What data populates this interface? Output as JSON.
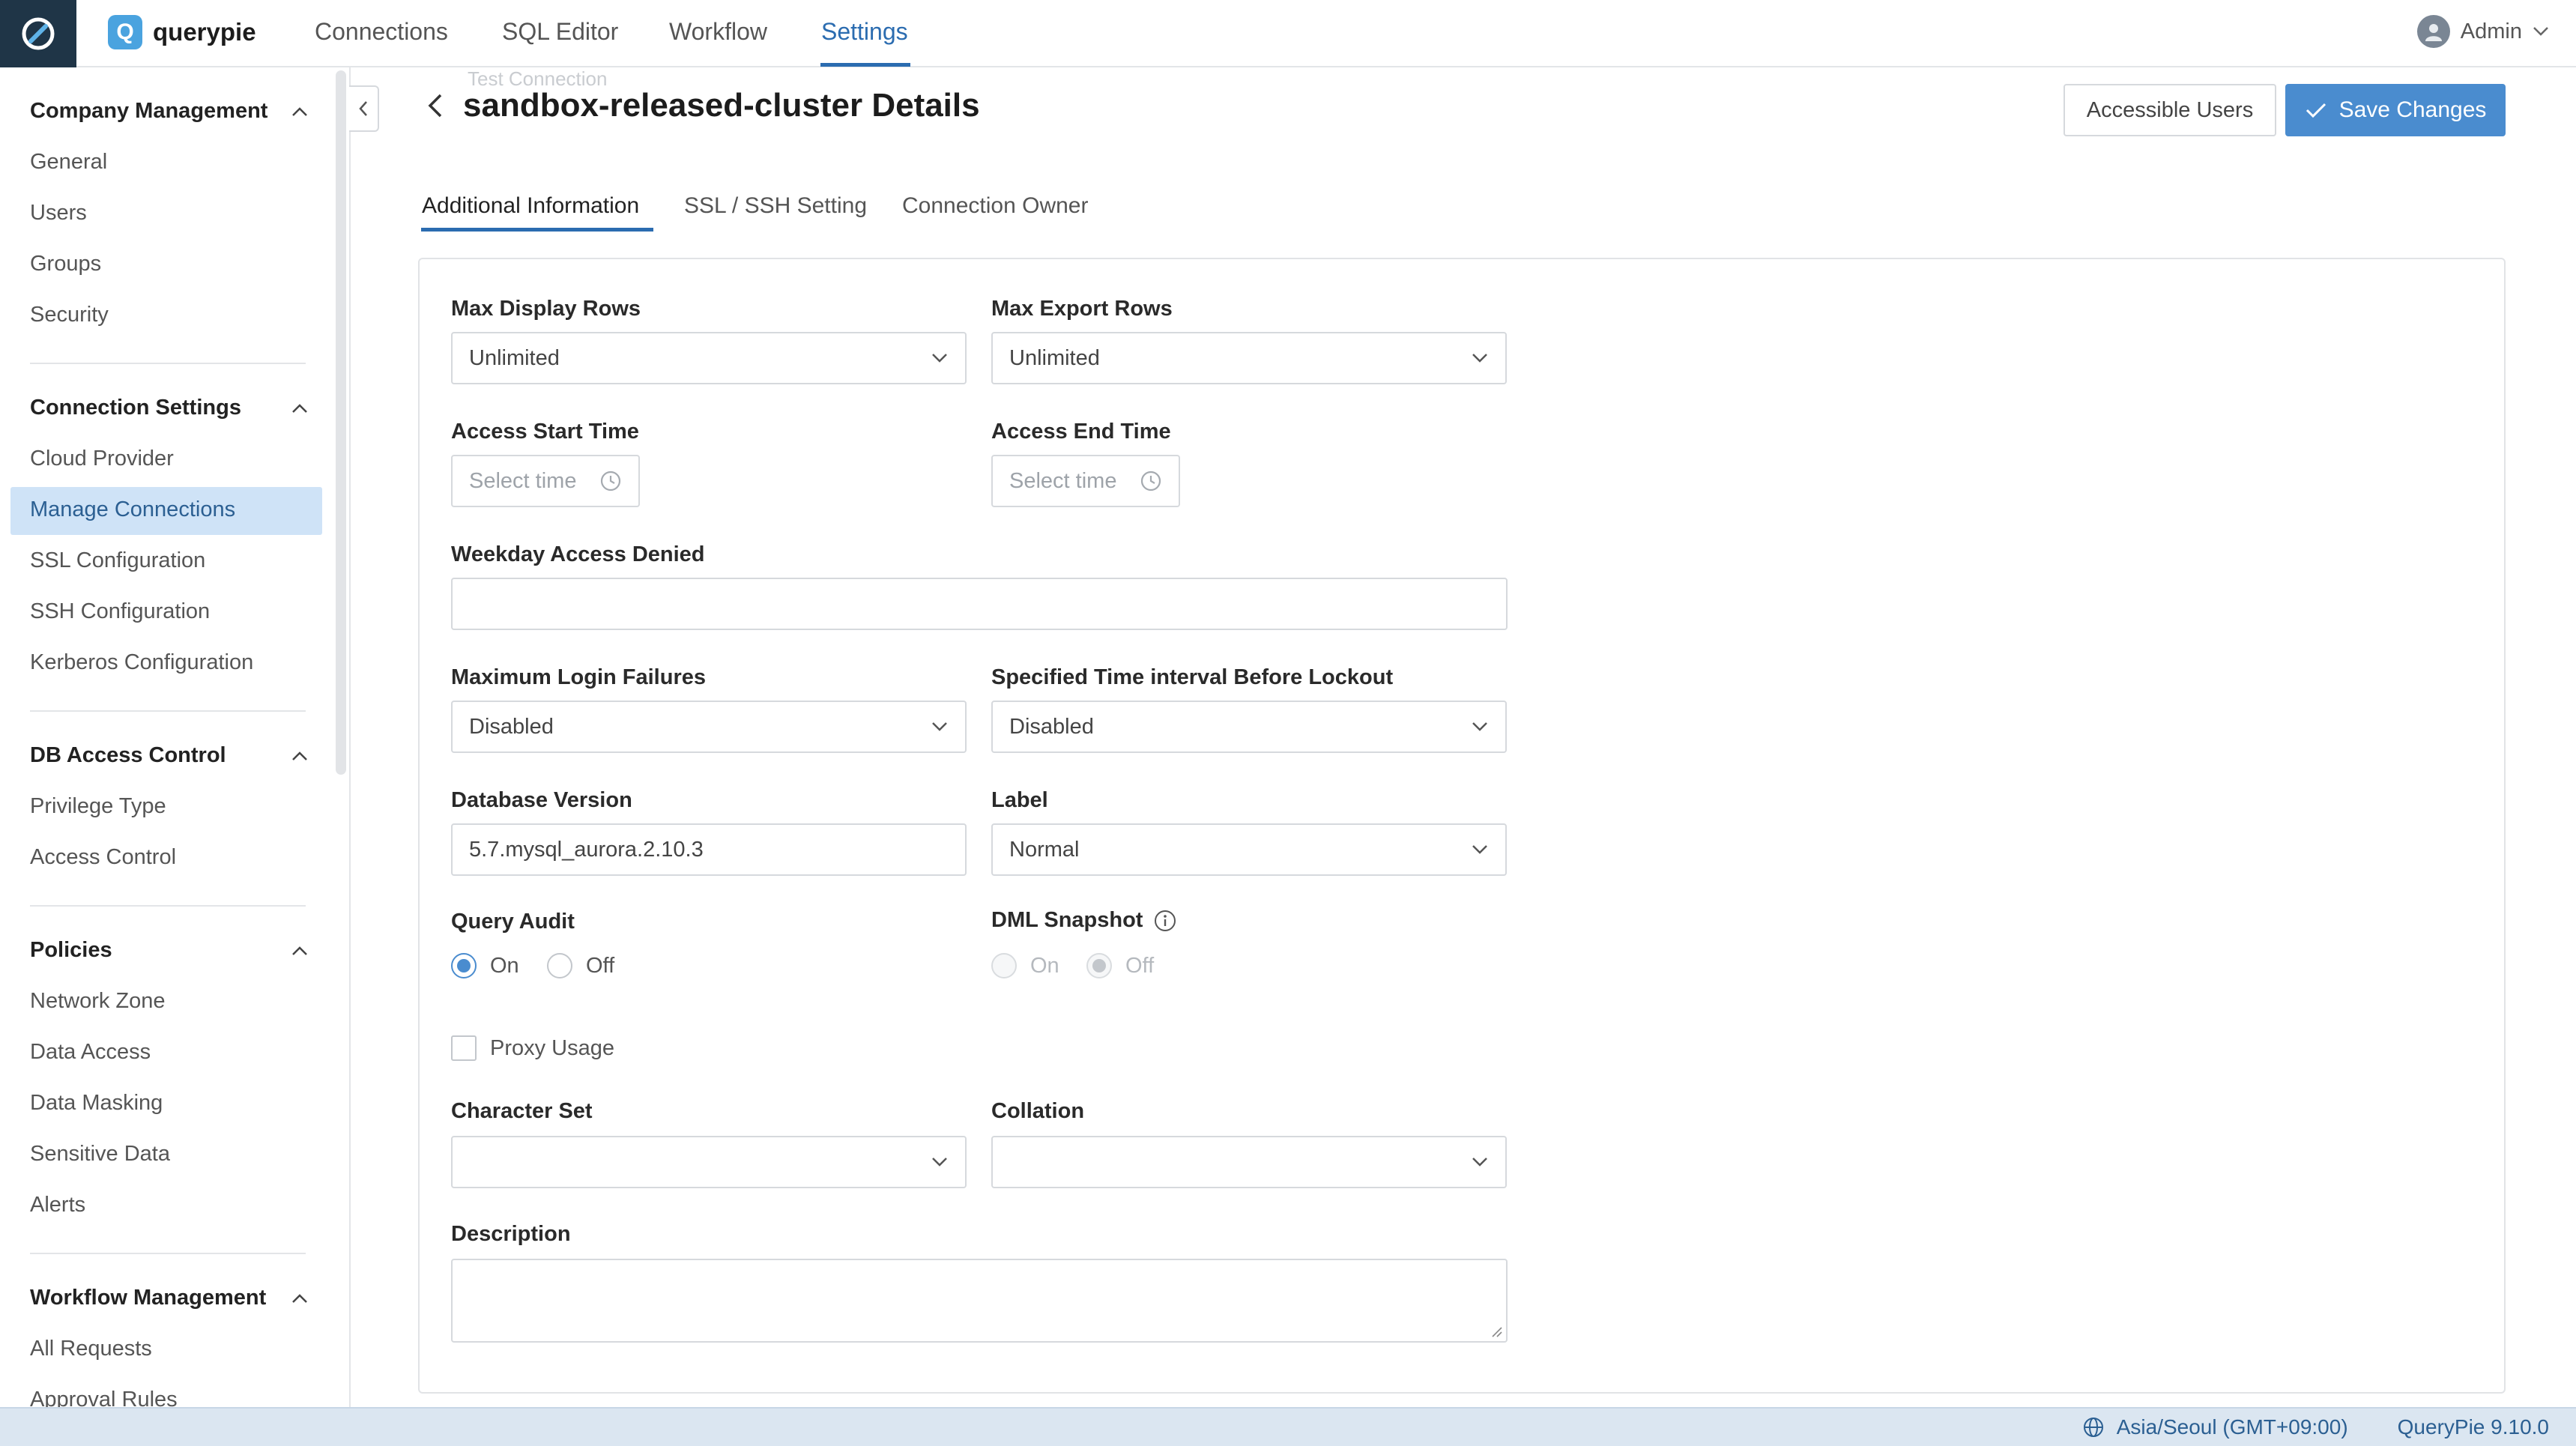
{
  "header": {
    "brand": "querypie",
    "nav": [
      "Connections",
      "SQL Editor",
      "Workflow",
      "Settings"
    ],
    "active_nav": "Settings",
    "user": "Admin"
  },
  "sidebar": {
    "sections": [
      {
        "title": "Company Management",
        "items": [
          "General",
          "Users",
          "Groups",
          "Security"
        ]
      },
      {
        "title": "Connection Settings",
        "items": [
          "Cloud Provider",
          "Manage Connections",
          "SSL Configuration",
          "SSH Configuration",
          "Kerberos Configuration"
        ]
      },
      {
        "title": "DB Access Control",
        "items": [
          "Privilege Type",
          "Access Control"
        ]
      },
      {
        "title": "Policies",
        "items": [
          "Network Zone",
          "Data Access",
          "Data Masking",
          "Sensitive Data",
          "Alerts"
        ]
      },
      {
        "title": "Workflow Management",
        "items": [
          "All Requests",
          "Approval Rules"
        ]
      }
    ],
    "active_item": "Manage Connections"
  },
  "page": {
    "ghost_label": "Test Connection",
    "title": "sandbox-released-cluster Details",
    "accessible_users": "Accessible Users",
    "save_changes": "Save Changes",
    "tabs": [
      "Additional Information",
      "SSL / SSH Setting",
      "Connection Owner"
    ],
    "active_tab": "Additional Information"
  },
  "form": {
    "max_display_rows": {
      "label": "Max Display Rows",
      "value": "Unlimited"
    },
    "max_export_rows": {
      "label": "Max Export Rows",
      "value": "Unlimited"
    },
    "access_start_time": {
      "label": "Access Start Time",
      "placeholder": "Select time"
    },
    "access_end_time": {
      "label": "Access End Time",
      "placeholder": "Select time"
    },
    "weekday_access_denied": {
      "label": "Weekday Access Denied",
      "value": ""
    },
    "max_login_failures": {
      "label": "Maximum Login Failures",
      "value": "Disabled"
    },
    "lockout_interval": {
      "label": "Specified Time interval Before Lockout",
      "value": "Disabled"
    },
    "database_version": {
      "label": "Database Version",
      "value": "5.7.mysql_aurora.2.10.3"
    },
    "label": {
      "label": "Label",
      "value": "Normal"
    },
    "query_audit": {
      "label": "Query Audit",
      "on": "On",
      "off": "Off",
      "selected": "On"
    },
    "dml_snapshot": {
      "label": "DML Snapshot",
      "on": "On",
      "off": "Off",
      "selected": "Off",
      "disabled": true
    },
    "proxy_usage": {
      "label": "Proxy Usage",
      "checked": false
    },
    "character_set": {
      "label": "Character Set",
      "value": ""
    },
    "collation": {
      "label": "Collation",
      "value": ""
    },
    "description": {
      "label": "Description",
      "value": ""
    }
  },
  "status": {
    "timezone": "Asia/Seoul (GMT+09:00)",
    "version": "QueryPie 9.10.0"
  },
  "colors": {
    "accent": "#2b6cb0",
    "primary_button": "#4a8ccf",
    "sidebar_active_bg": "#cfe3f7",
    "apps_button_bg": "#1f3547",
    "status_bar_bg": "#dbe6f1"
  }
}
